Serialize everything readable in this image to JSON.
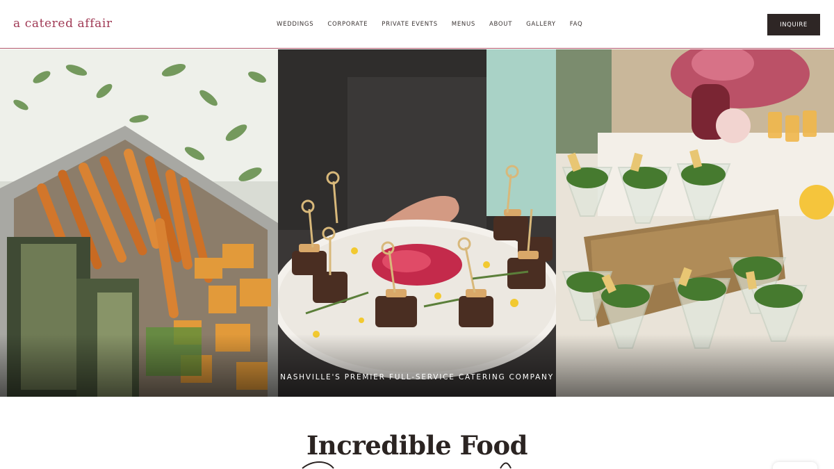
{
  "header": {
    "logo_text": "a catered affair",
    "nav": [
      "WEDDINGS",
      "CORPORATE",
      "PRIVATE EVENTS",
      "MENUS",
      "ABOUT",
      "GALLERY",
      "FAQ"
    ],
    "cta_label": "INQUIRE"
  },
  "hero": {
    "tagline": "NASHVILLE'S PREMIER FULL-SERVICE CATERING COMPANY",
    "panels": [
      "roasted-vegetables-photo",
      "skewered-appetizers-photo",
      "salad-cups-photo"
    ]
  },
  "intro": {
    "heading": "Incredible Food"
  },
  "colors": {
    "brand": "#a03a55",
    "cta_bg": "#2e2625",
    "header_rule": "#b2556a"
  }
}
